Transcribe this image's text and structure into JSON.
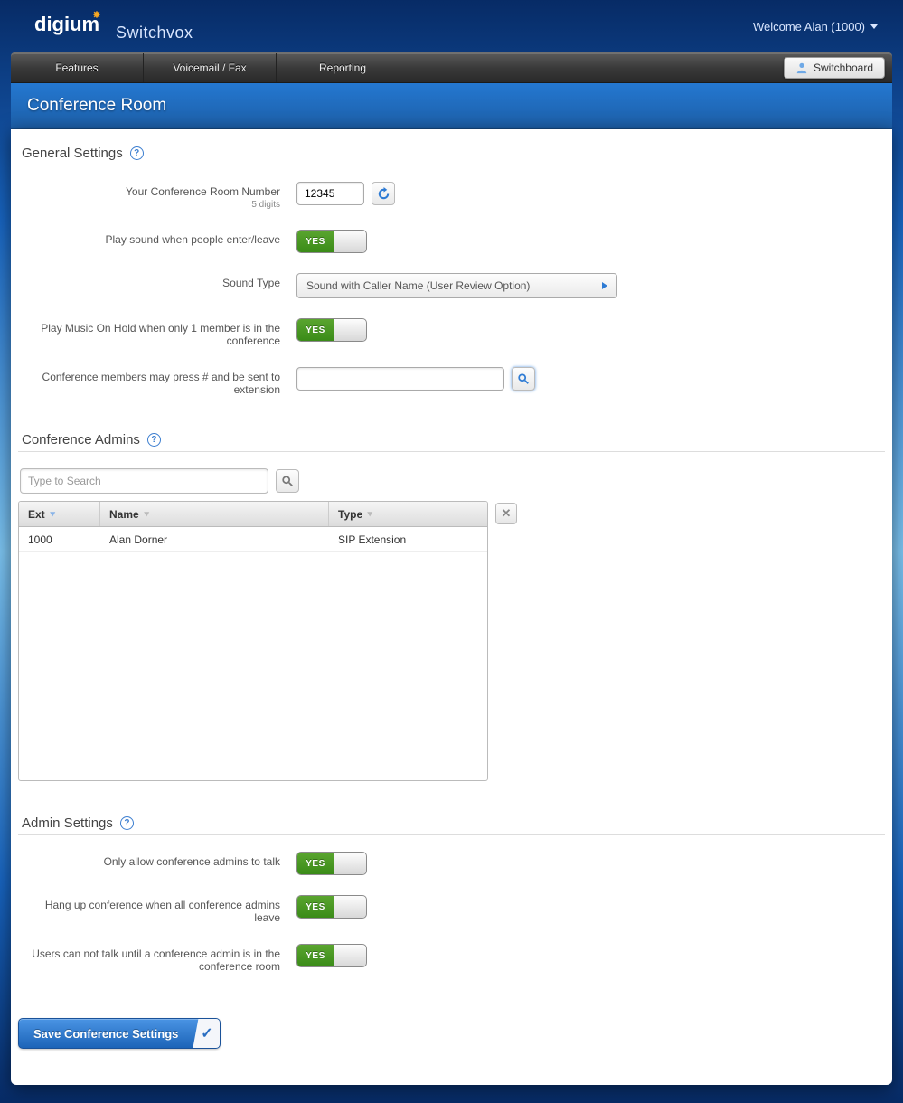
{
  "brand": {
    "name": "digium",
    "product": "Switchvox"
  },
  "welcome": "Welcome Alan (1000)",
  "nav": {
    "items": [
      "Features",
      "Voicemail / Fax",
      "Reporting"
    ],
    "switchboard": "Switchboard"
  },
  "page_title": "Conference Room",
  "sections": {
    "general": {
      "title": "General Settings",
      "fields": {
        "room_number": {
          "label": "Your Conference Room Number",
          "hint": "5 digits",
          "value": "12345"
        },
        "play_sound": {
          "label": "Play sound when people enter/leave",
          "value": "YES"
        },
        "sound_type": {
          "label": "Sound Type",
          "value": "Sound with Caller Name (User Review Option)"
        },
        "moh": {
          "label": "Play Music On Hold when only 1 member is in the conference",
          "value": "YES"
        },
        "press_hash": {
          "label": "Conference members may press # and be sent to extension",
          "value": ""
        }
      }
    },
    "admins": {
      "title": "Conference Admins",
      "search_placeholder": "Type to Search",
      "columns": {
        "ext": "Ext",
        "name": "Name",
        "type": "Type"
      },
      "rows": [
        {
          "ext": "1000",
          "name": "Alan Dorner",
          "type": "SIP Extension"
        }
      ]
    },
    "admin_settings": {
      "title": "Admin Settings",
      "fields": {
        "only_admins_talk": {
          "label": "Only allow conference admins to talk",
          "value": "YES"
        },
        "hangup_when_leave": {
          "label": "Hang up conference when all conference admins leave",
          "value": "YES"
        },
        "mute_until_admin": {
          "label": "Users can not talk until a conference admin is in the conference room",
          "value": "YES"
        }
      }
    }
  },
  "save_button": "Save Conference Settings"
}
